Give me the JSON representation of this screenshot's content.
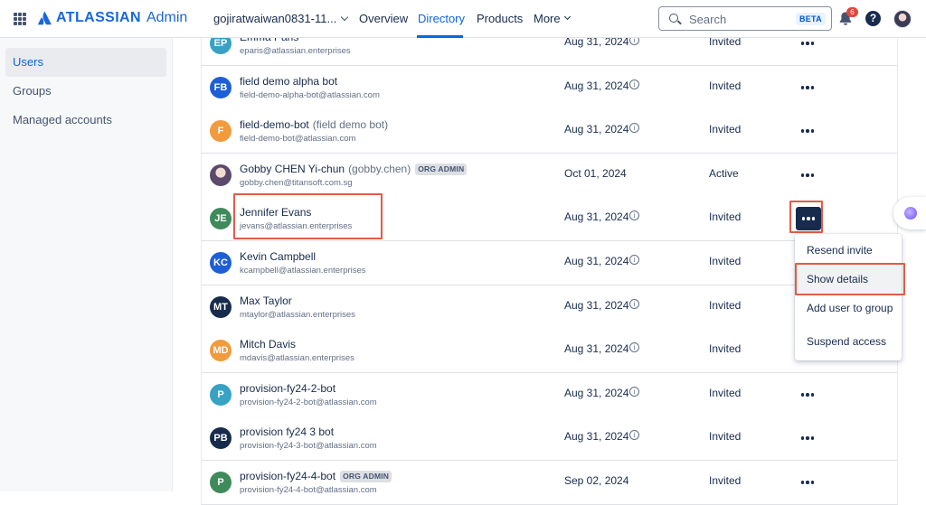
{
  "topnav": {
    "logo_word": "ATLASSIAN",
    "logo_product": "Admin",
    "org_name": "gojiratwaiwan0831-11...",
    "tabs": [
      {
        "label": "Overview"
      },
      {
        "label": "Directory",
        "active": true
      },
      {
        "label": "Products"
      },
      {
        "label": "More"
      }
    ],
    "search_placeholder": "Search",
    "search_badge": "BETA",
    "notification_count": "6",
    "help_glyph": "?"
  },
  "sidebar": {
    "items": [
      {
        "label": "Users",
        "active": true
      },
      {
        "label": "Groups"
      },
      {
        "label": "Managed accounts"
      }
    ]
  },
  "users": [
    {
      "initials": "EP",
      "avatar_color": "#37a2c3",
      "name": "Emma Paris",
      "nickname": "",
      "email": "eparis@atlassian.enterprises",
      "date": "Aug 31, 2024",
      "status": "Invited",
      "info": true
    },
    {
      "initials": "FB",
      "avatar_color": "#1d5fd6",
      "name": "field demo alpha bot",
      "nickname": "",
      "email": "field-demo-alpha-bot@atlassian.com",
      "date": "Aug 31, 2024",
      "status": "Invited",
      "info": true
    },
    {
      "initials": "F",
      "avatar_color": "#f19a3e",
      "name": "field-demo-bot",
      "nickname": "(field demo bot)",
      "email": "field-demo-bot@atlassian.com",
      "date": "Aug 31, 2024",
      "status": "Invited",
      "info": true
    },
    {
      "initials": "",
      "avatar_color": "#d9c7d6",
      "name": "Gobby CHEN Yi-chun",
      "nickname": "(gobby.chen)",
      "badge": "ORG ADMIN",
      "email": "gobby.chen@titansoft.com.sg",
      "date": "Oct 01, 2024",
      "status": "Active",
      "info": false
    },
    {
      "initials": "JE",
      "avatar_color": "#3f8a5b",
      "name": "Jennifer Evans",
      "nickname": "",
      "email": "jevans@atlassian.enterprises",
      "date": "Aug 31, 2024",
      "status": "Invited",
      "info": true
    },
    {
      "initials": "KC",
      "avatar_color": "#1d5fd6",
      "name": "Kevin Campbell",
      "nickname": "",
      "email": "kcampbell@atlassian.enterprises",
      "date": "Aug 31, 2024",
      "status": "Invited",
      "info": true
    },
    {
      "initials": "MT",
      "avatar_color": "#172b4d",
      "name": "Max Taylor",
      "nickname": "",
      "email": "mtaylor@atlassian.enterprises",
      "date": "Aug 31, 2024",
      "status": "Invited",
      "info": true
    },
    {
      "initials": "MD",
      "avatar_color": "#f19a3e",
      "name": "Mitch Davis",
      "nickname": "",
      "email": "mdavis@atlassian.enterprises",
      "date": "Aug 31, 2024",
      "status": "Invited",
      "info": true
    },
    {
      "initials": "P",
      "avatar_color": "#37a2c3",
      "name": "provision-fy24-2-bot",
      "nickname": "",
      "email": "provision-fy24-2-bot@atlassian.com",
      "date": "Aug 31, 2024",
      "status": "Invited",
      "info": true
    },
    {
      "initials": "PB",
      "avatar_color": "#172b4d",
      "name": "provision fy24 3 bot",
      "nickname": "",
      "email": "provision-fy24-3-bot@atlassian.com",
      "date": "Aug 31, 2024",
      "status": "Invited",
      "info": true
    },
    {
      "initials": "P",
      "avatar_color": "#3f8a5b",
      "name": "provision-fy24-4-bot",
      "nickname": "",
      "badge": "ORG ADMIN",
      "email": "provision-fy24-4-bot@atlassian.com",
      "date": "Sep 02, 2024",
      "status": "Invited",
      "info": false
    }
  ],
  "actions_menu": {
    "items": [
      {
        "label": "Resend invite"
      },
      {
        "label": "Show details",
        "highlighted": true
      },
      {
        "label": "Add user to group"
      },
      {
        "label": "Suspend access"
      }
    ]
  },
  "info_glyph": "i",
  "colors": {
    "brand_blue": "#1868db",
    "link_blue": "#0c66e4",
    "highlight_red": "#e25b45",
    "badge_red": "#e2483d"
  }
}
